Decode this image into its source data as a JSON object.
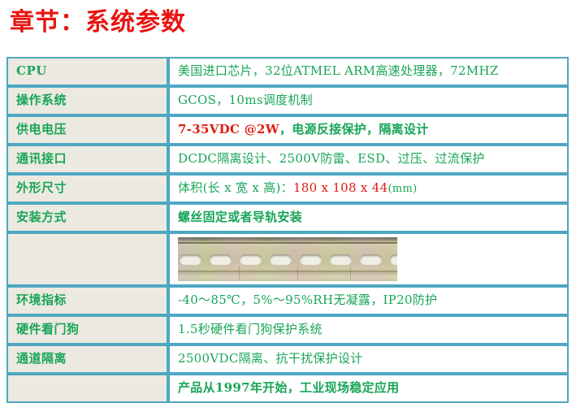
{
  "page": {
    "title": "章节：系统参数",
    "title_color": "#e81410",
    "background": "#ffffff"
  },
  "theme": {
    "border_color": "#4ea7c2",
    "label_bg": "#eceae0",
    "value_bg": "#ffffff",
    "text_green": "#18a558",
    "text_red": "#e01b10"
  },
  "spec_table": {
    "rows": [
      {
        "label": "CPU",
        "value": "美国进口芯片，32位ATMEL ARM高速处理器，72MHZ",
        "type": "text"
      },
      {
        "label": "操作系统",
        "value": "GCOS，10ms调度机制",
        "type": "text"
      },
      {
        "label": "供电电压",
        "type": "mixed",
        "value_red": "7-35VDC @2W",
        "value_green": "，电源反接保护，隔离设计"
      },
      {
        "label": "通讯接口",
        "value": "DCDC隔离设计、2500V防雷、ESD、过压、过流保护",
        "type": "text"
      },
      {
        "label": "外形尺寸",
        "type": "dimension",
        "value_prefix": "体积(长 x 宽 x 高)：",
        "value_red": "180 x 108 x 44",
        "value_unit": "(mm)"
      },
      {
        "label": "安装方式",
        "value": "螺丝固定或者导轨安装",
        "type": "text"
      },
      {
        "label": "",
        "value": "",
        "type": "image",
        "image_name": "din-rail-photo"
      },
      {
        "label": "环境指标",
        "value": "-40～85℃，5%～95%RH无凝露，IP20防护",
        "type": "text"
      },
      {
        "label": "硬件看门狗",
        "value": "1.5秒硬件看门狗保护系统",
        "type": "text"
      },
      {
        "label": "通道隔离",
        "value": "2500VDC隔离、抗干扰保护设计",
        "type": "text"
      },
      {
        "label": "",
        "value": "产品从1997年开始，工业现场稳定应用",
        "type": "text"
      }
    ]
  }
}
